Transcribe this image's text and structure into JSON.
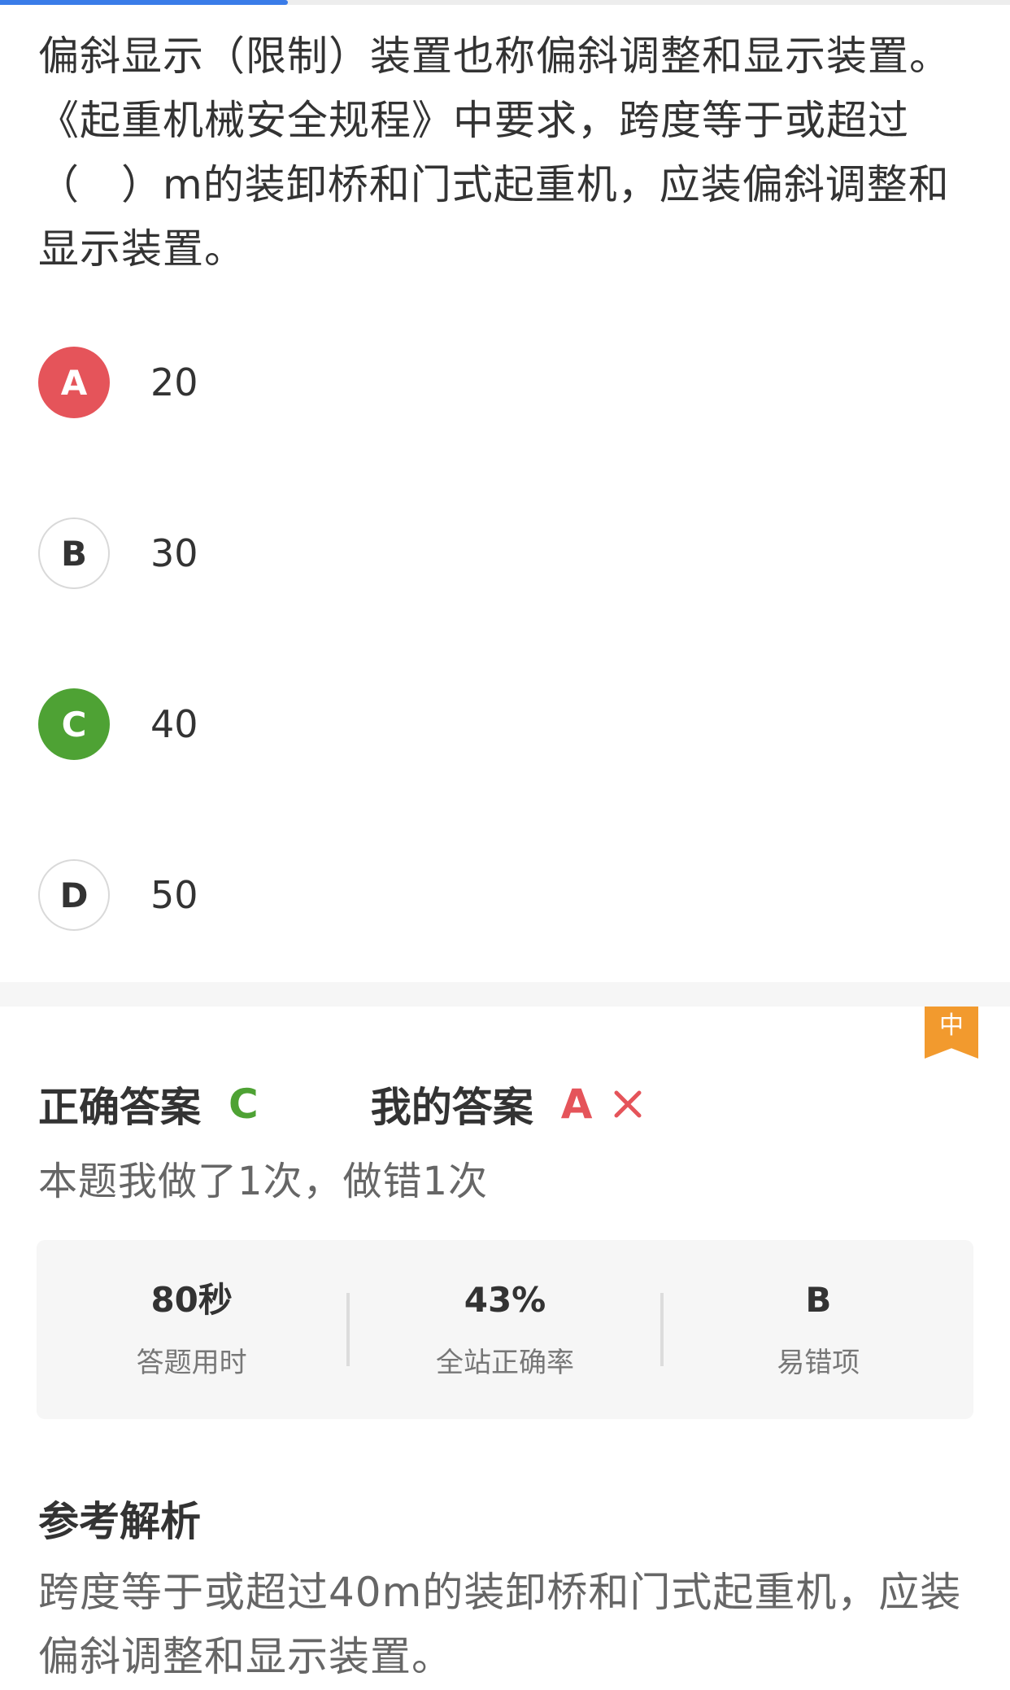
{
  "progress": {
    "fraction": 0.285
  },
  "question": {
    "text": "偏斜显示（限制）装置也称偏斜调整和显示装置。《起重机械安全规程》中要求，跨度等于或超过（　）m的装卸桥和门式起重机，应装偏斜调整和显示装置。"
  },
  "options": [
    {
      "letter": "A",
      "text": "20",
      "state": "wrong"
    },
    {
      "letter": "B",
      "text": "30",
      "state": "plain"
    },
    {
      "letter": "C",
      "text": "40",
      "state": "right"
    },
    {
      "letter": "D",
      "text": "50",
      "state": "plain"
    }
  ],
  "difficulty": {
    "label": "中",
    "color": "#f29a2e"
  },
  "answer": {
    "correct_label": "正确答案",
    "correct_value": "C",
    "mine_label": "我的答案",
    "mine_value": "A",
    "mine_icon": "cross-icon"
  },
  "attempts": {
    "text": "本题我做了1次，做错1次"
  },
  "stats": [
    {
      "value": "80秒",
      "label": "答题用时"
    },
    {
      "value": "43%",
      "label": "全站正确率"
    },
    {
      "value": "B",
      "label": "易错项"
    }
  ],
  "analysis": {
    "title": "参考解析",
    "text": "跨度等于或超过40m的装卸桥和门式起重机，应装偏斜调整和显示装置。"
  },
  "colors": {
    "correct": "#4ea234",
    "wrong": "#e5545a",
    "accent": "#3a7ce8"
  }
}
